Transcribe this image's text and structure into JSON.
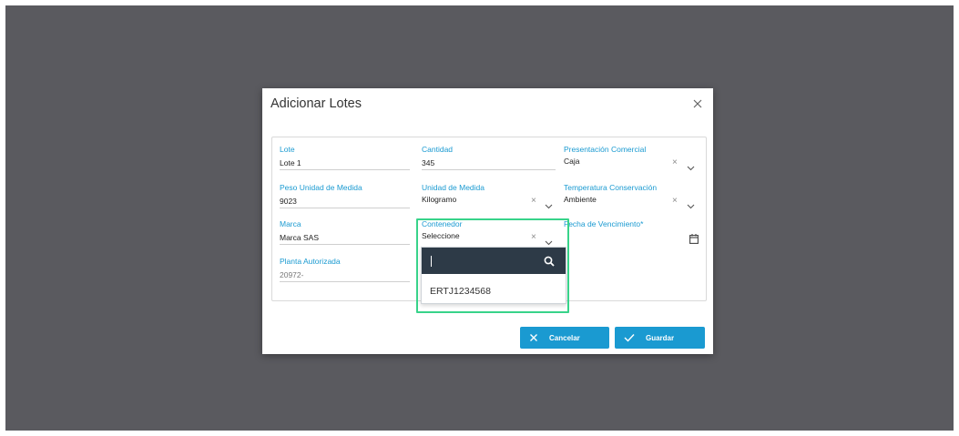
{
  "modal": {
    "title": "Adicionar Lotes"
  },
  "fields": {
    "lote": {
      "label": "Lote",
      "value": "Lote 1"
    },
    "cantidad": {
      "label": "Cantidad",
      "value": "345"
    },
    "presentacion": {
      "label": "Presentación Comercial",
      "value": "Caja"
    },
    "peso": {
      "label": "Peso Unidad de Medida",
      "value": "9023"
    },
    "unidad": {
      "label": "Unidad de Medida",
      "value": "Kilogramo"
    },
    "temperatura": {
      "label": "Temperatura Conservación",
      "value": "Ambiente"
    },
    "marca": {
      "label": "Marca",
      "value": "Marca SAS"
    },
    "contenedor": {
      "label": "Contenedor",
      "value": "Seleccione"
    },
    "fecha": {
      "label": "Fecha de Vencimiento*",
      "value": ""
    },
    "planta": {
      "label": "Planta Autorizada",
      "value": "20972-"
    }
  },
  "dropdown": {
    "search_value": "",
    "options": [
      "ERTJ1234568"
    ]
  },
  "buttons": {
    "cancel_label": "Cancelar",
    "save_label": "Guardar"
  },
  "colors": {
    "accent": "#1a9ad1",
    "highlight": "#38d38a",
    "dropdown_header": "#2d3a47",
    "backdrop": "#5a5a5f"
  },
  "icons": [
    "close-icon",
    "chevron-down-icon",
    "clear-icon",
    "calendar-icon",
    "search-icon",
    "check-icon"
  ]
}
